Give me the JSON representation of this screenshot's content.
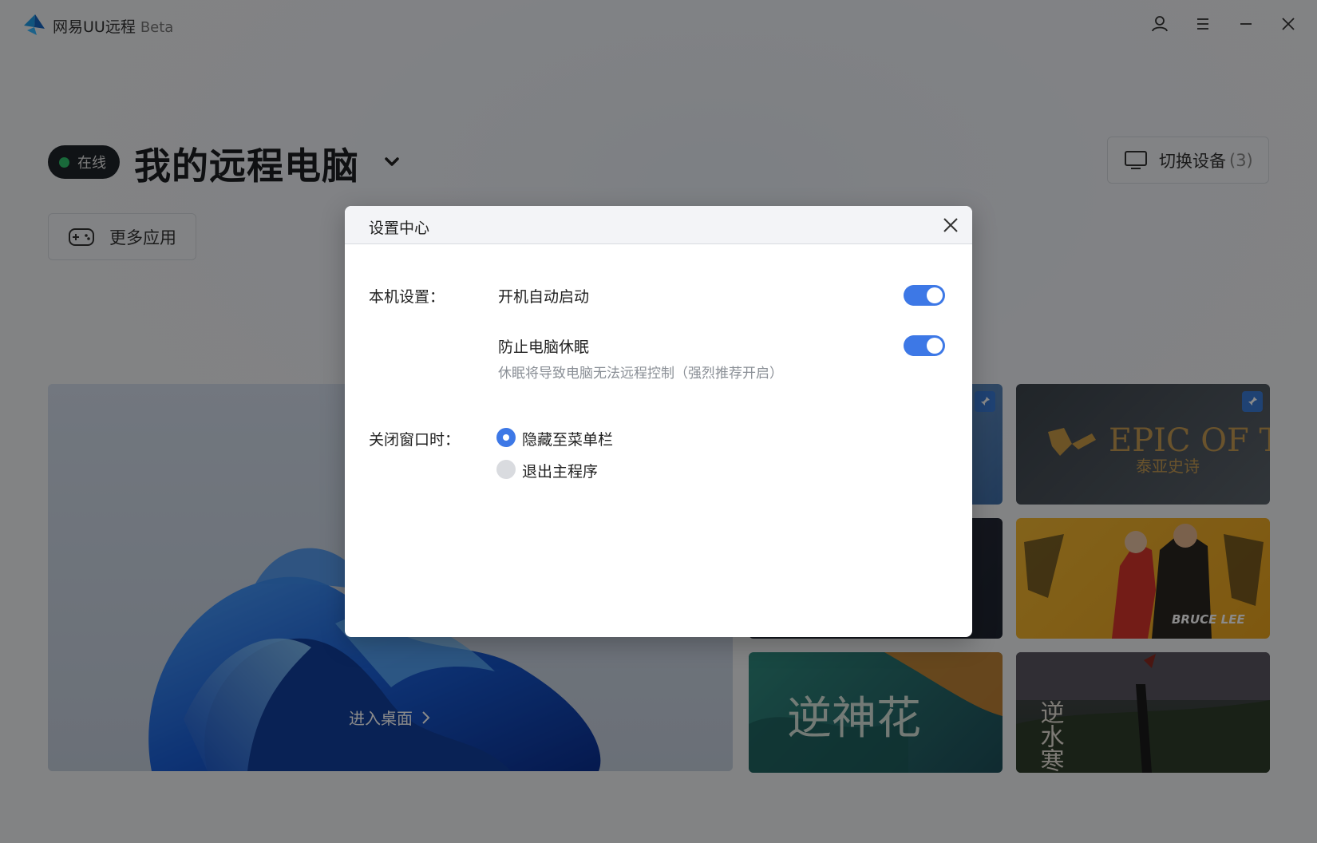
{
  "app": {
    "title": "网易UU远程",
    "beta": "Beta"
  },
  "header": {
    "status": "在线",
    "title": "我的远程电脑",
    "switch_device_label": "切换设备",
    "switch_device_count": "(3)",
    "more_apps_label": "更多应用"
  },
  "desktop": {
    "enter_label": "进入桌面"
  },
  "tiles": [
    {
      "name": "Epic of TIA",
      "text_line1": "EPIC OF TIA",
      "text_line2": "泰亚史诗"
    },
    {
      "name": "Bruce Lee",
      "text": "BRUCE LEE"
    },
    {
      "name": "逆神花",
      "text": "逆神花"
    },
    {
      "name": "逆水寒",
      "text": "逆水寒"
    }
  ],
  "dialog": {
    "title": "设置中心",
    "local_settings_label": "本机设置：",
    "options": [
      {
        "label": "开机自动启动",
        "enabled": true
      },
      {
        "label": "防止电脑休眠",
        "enabled": true,
        "description": "休眠将导致电脑无法远程控制（强烈推荐开启）"
      }
    ],
    "close_window_label": "关闭窗口时：",
    "close_choices": [
      {
        "label": "隐藏至菜单栏",
        "selected": true
      },
      {
        "label": "退出主程序",
        "selected": false
      }
    ]
  },
  "colors": {
    "accent": "#3d78e6",
    "online": "#2fc26b"
  }
}
